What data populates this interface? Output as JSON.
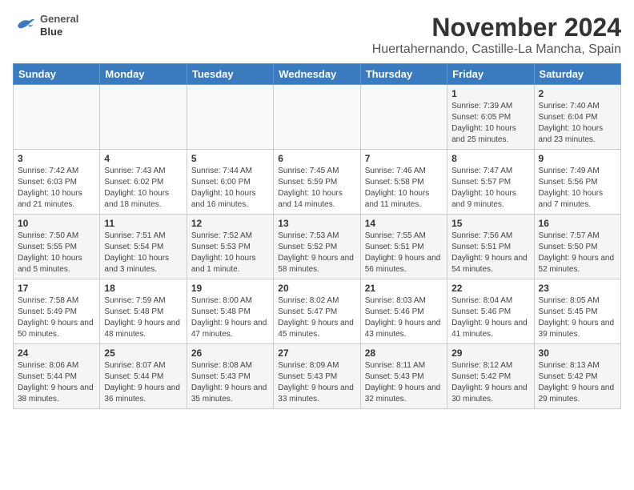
{
  "header": {
    "logo_line1": "General",
    "logo_line2": "Blue",
    "title": "November 2024",
    "subtitle": "Huertahernando, Castille-La Mancha, Spain"
  },
  "weekdays": [
    "Sunday",
    "Monday",
    "Tuesday",
    "Wednesday",
    "Thursday",
    "Friday",
    "Saturday"
  ],
  "weeks": [
    [
      {
        "day": "",
        "info": ""
      },
      {
        "day": "",
        "info": ""
      },
      {
        "day": "",
        "info": ""
      },
      {
        "day": "",
        "info": ""
      },
      {
        "day": "",
        "info": ""
      },
      {
        "day": "1",
        "info": "Sunrise: 7:39 AM\nSunset: 6:05 PM\nDaylight: 10 hours and 25 minutes."
      },
      {
        "day": "2",
        "info": "Sunrise: 7:40 AM\nSunset: 6:04 PM\nDaylight: 10 hours and 23 minutes."
      }
    ],
    [
      {
        "day": "3",
        "info": "Sunrise: 7:42 AM\nSunset: 6:03 PM\nDaylight: 10 hours and 21 minutes."
      },
      {
        "day": "4",
        "info": "Sunrise: 7:43 AM\nSunset: 6:02 PM\nDaylight: 10 hours and 18 minutes."
      },
      {
        "day": "5",
        "info": "Sunrise: 7:44 AM\nSunset: 6:00 PM\nDaylight: 10 hours and 16 minutes."
      },
      {
        "day": "6",
        "info": "Sunrise: 7:45 AM\nSunset: 5:59 PM\nDaylight: 10 hours and 14 minutes."
      },
      {
        "day": "7",
        "info": "Sunrise: 7:46 AM\nSunset: 5:58 PM\nDaylight: 10 hours and 11 minutes."
      },
      {
        "day": "8",
        "info": "Sunrise: 7:47 AM\nSunset: 5:57 PM\nDaylight: 10 hours and 9 minutes."
      },
      {
        "day": "9",
        "info": "Sunrise: 7:49 AM\nSunset: 5:56 PM\nDaylight: 10 hours and 7 minutes."
      }
    ],
    [
      {
        "day": "10",
        "info": "Sunrise: 7:50 AM\nSunset: 5:55 PM\nDaylight: 10 hours and 5 minutes."
      },
      {
        "day": "11",
        "info": "Sunrise: 7:51 AM\nSunset: 5:54 PM\nDaylight: 10 hours and 3 minutes."
      },
      {
        "day": "12",
        "info": "Sunrise: 7:52 AM\nSunset: 5:53 PM\nDaylight: 10 hours and 1 minute."
      },
      {
        "day": "13",
        "info": "Sunrise: 7:53 AM\nSunset: 5:52 PM\nDaylight: 9 hours and 58 minutes."
      },
      {
        "day": "14",
        "info": "Sunrise: 7:55 AM\nSunset: 5:51 PM\nDaylight: 9 hours and 56 minutes."
      },
      {
        "day": "15",
        "info": "Sunrise: 7:56 AM\nSunset: 5:51 PM\nDaylight: 9 hours and 54 minutes."
      },
      {
        "day": "16",
        "info": "Sunrise: 7:57 AM\nSunset: 5:50 PM\nDaylight: 9 hours and 52 minutes."
      }
    ],
    [
      {
        "day": "17",
        "info": "Sunrise: 7:58 AM\nSunset: 5:49 PM\nDaylight: 9 hours and 50 minutes."
      },
      {
        "day": "18",
        "info": "Sunrise: 7:59 AM\nSunset: 5:48 PM\nDaylight: 9 hours and 48 minutes."
      },
      {
        "day": "19",
        "info": "Sunrise: 8:00 AM\nSunset: 5:48 PM\nDaylight: 9 hours and 47 minutes."
      },
      {
        "day": "20",
        "info": "Sunrise: 8:02 AM\nSunset: 5:47 PM\nDaylight: 9 hours and 45 minutes."
      },
      {
        "day": "21",
        "info": "Sunrise: 8:03 AM\nSunset: 5:46 PM\nDaylight: 9 hours and 43 minutes."
      },
      {
        "day": "22",
        "info": "Sunrise: 8:04 AM\nSunset: 5:46 PM\nDaylight: 9 hours and 41 minutes."
      },
      {
        "day": "23",
        "info": "Sunrise: 8:05 AM\nSunset: 5:45 PM\nDaylight: 9 hours and 39 minutes."
      }
    ],
    [
      {
        "day": "24",
        "info": "Sunrise: 8:06 AM\nSunset: 5:44 PM\nDaylight: 9 hours and 38 minutes."
      },
      {
        "day": "25",
        "info": "Sunrise: 8:07 AM\nSunset: 5:44 PM\nDaylight: 9 hours and 36 minutes."
      },
      {
        "day": "26",
        "info": "Sunrise: 8:08 AM\nSunset: 5:43 PM\nDaylight: 9 hours and 35 minutes."
      },
      {
        "day": "27",
        "info": "Sunrise: 8:09 AM\nSunset: 5:43 PM\nDaylight: 9 hours and 33 minutes."
      },
      {
        "day": "28",
        "info": "Sunrise: 8:11 AM\nSunset: 5:43 PM\nDaylight: 9 hours and 32 minutes."
      },
      {
        "day": "29",
        "info": "Sunrise: 8:12 AM\nSunset: 5:42 PM\nDaylight: 9 hours and 30 minutes."
      },
      {
        "day": "30",
        "info": "Sunrise: 8:13 AM\nSunset: 5:42 PM\nDaylight: 9 hours and 29 minutes."
      }
    ]
  ]
}
